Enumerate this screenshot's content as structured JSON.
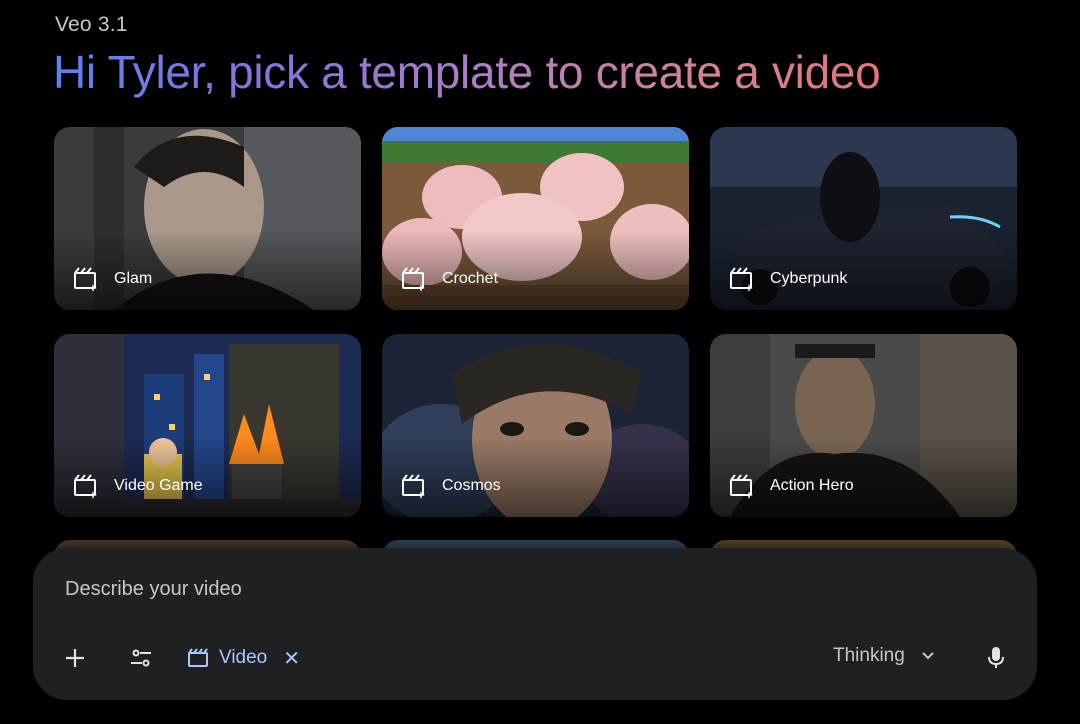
{
  "header": {
    "model": "Veo 3.1",
    "headline": "Hi Tyler, pick a template to create a video"
  },
  "templates": [
    {
      "label": "Glam",
      "icon": "video-spark-icon"
    },
    {
      "label": "Crochet",
      "icon": "video-spark-icon"
    },
    {
      "label": "Cyberpunk",
      "icon": "video-spark-icon"
    },
    {
      "label": "Video Game",
      "icon": "video-spark-icon"
    },
    {
      "label": "Cosmos",
      "icon": "video-spark-icon"
    },
    {
      "label": "Action Hero",
      "icon": "video-spark-icon"
    }
  ],
  "composer": {
    "placeholder": "Describe your video",
    "chip_label": "Video",
    "mode_label": "Thinking"
  },
  "colors": {
    "background": "#000000",
    "composer_bg": "#1f2023",
    "chip_accent": "#a8c7fa",
    "gradient_start": "#5b82f0",
    "gradient_end": "#e0767a"
  }
}
